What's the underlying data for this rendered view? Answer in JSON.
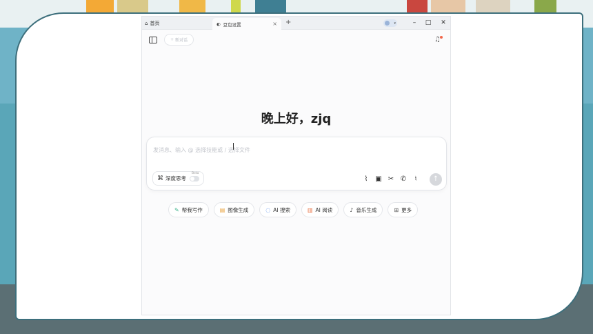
{
  "browser": {
    "home_tab_label": "首页",
    "active_tab_label": "豆包设置",
    "new_tab_symbol": "+",
    "window_controls": {
      "minimize": "–",
      "maximize": "□",
      "close": "✕"
    }
  },
  "toolbar": {
    "new_chat_label": "新对话"
  },
  "main": {
    "greeting": "晚上好，zjq",
    "input_placeholder": "发消息、输入 @ 选择技能或 / 选择文件",
    "deep_think_label": "深度思考",
    "deep_think_badge": "Beta",
    "input_tools": [
      "attach-icon",
      "image-icon",
      "scissors-icon",
      "phone-icon",
      "mic-icon"
    ],
    "send_symbol": "↑"
  },
  "quick_actions": [
    {
      "icon": "write-icon",
      "label": "帮我写作",
      "color": "#3bb38a"
    },
    {
      "icon": "image-gen-icon",
      "label": "图像生成",
      "color": "#e8a23b"
    },
    {
      "icon": "ai-search-icon",
      "label": "AI 搜索",
      "color": "#3a7be8"
    },
    {
      "icon": "ai-read-icon",
      "label": "AI 阅读",
      "color": "#e86a3b"
    },
    {
      "icon": "music-icon",
      "label": "音乐生成",
      "color": "#555555"
    },
    {
      "icon": "more-icon",
      "label": "更多",
      "color": "#555555"
    }
  ]
}
